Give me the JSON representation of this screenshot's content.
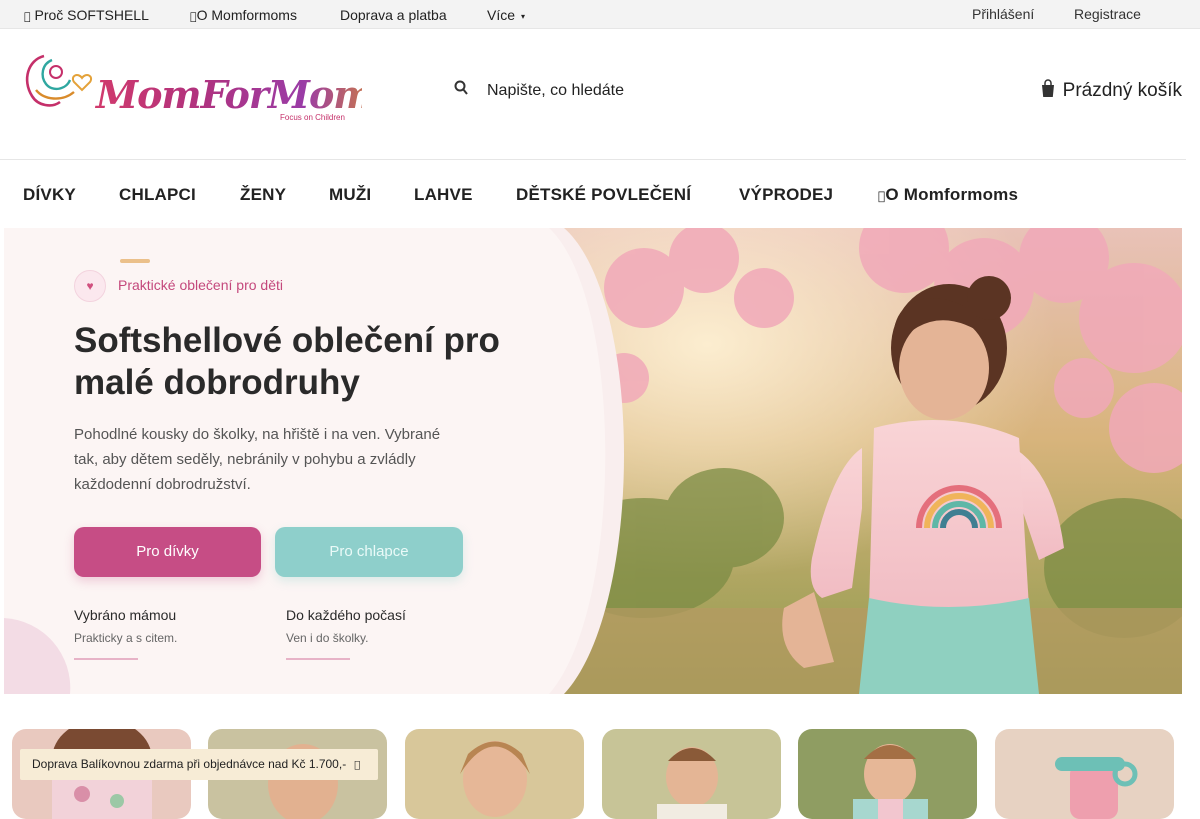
{
  "topbar": {
    "why": "Proč SOFTSHELL",
    "about": "O Momformoms",
    "shipping": "Doprava a platba",
    "more": "Více",
    "login": "Přihlášení",
    "register": "Registrace",
    "icons": [
      "info-icon",
      "info-icon",
      "chevron-down-icon"
    ]
  },
  "logo": {
    "brand": "MomForMoms",
    "tagline": "Focus on Children"
  },
  "search": {
    "placeholder": "Napište, co hledáte",
    "icon": "search-icon"
  },
  "cart": {
    "label": "Prázdný košík",
    "icon": "cart-icon"
  },
  "nav": {
    "items": [
      "DÍVKY",
      "CHLAPCI",
      "ŽENY",
      "MUŽI",
      "LAHVE",
      "DĚTSKÉ POVLEČENÍ",
      "VÝPRODEJ",
      "O Momformoms"
    ]
  },
  "hero": {
    "kicker": "Praktické oblečení pro děti",
    "title": "Softshellové oblečení pro malé dobrodruhy",
    "description": "Pohodlné kousky do školky, na hřiště i na ven. Vybrané tak, aby dětem seděly, nebránily v pohybu a zvládly každodenní dobrodružství.",
    "btn_girls": "Pro dívky",
    "btn_boys": "Pro chlapce",
    "features": [
      {
        "title": "Vybráno mámou",
        "sub": "Prakticky a s citem."
      },
      {
        "title": "Do každého počasí",
        "sub": "Ven i do školky."
      }
    ],
    "icons": [
      "heart-icon"
    ]
  },
  "notice": {
    "text": "Doprava Balíkovnou zdarma při objednávce nad Kč 1.700,-",
    "icon": "close-icon"
  },
  "colors": {
    "accent_pink": "#c64d85",
    "accent_mint": "#8ecfcb",
    "notice_bg": "#f7ecd6",
    "topbar_bg": "#f3f3f3"
  }
}
